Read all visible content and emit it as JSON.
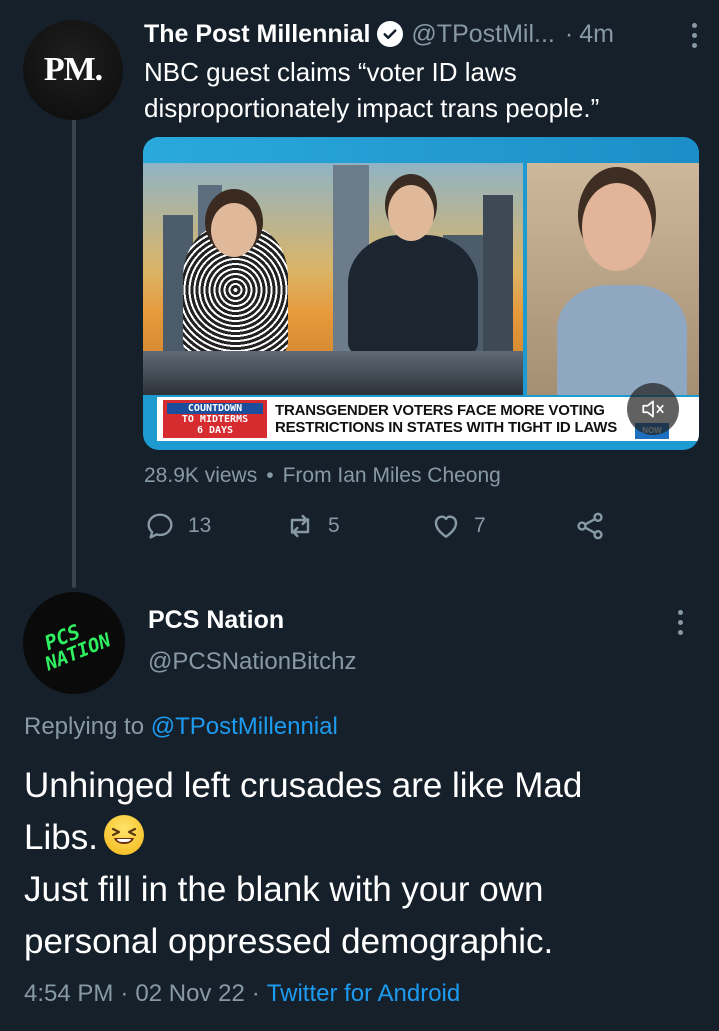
{
  "tweet1": {
    "avatar_text": "PM.",
    "name": "The Post Millennial",
    "handle": "@TPostMil...",
    "separator": "·",
    "time": "4m",
    "text_line1": "NBC guest claims “voter ID laws",
    "text_line2": "disproportionately impact trans people.”",
    "media": {
      "countdown_line1": "COUNTDOWN",
      "countdown_line2": "TO MIDTERMS",
      "countdown_line3": "6 DAYS",
      "headline_line1": "TRANSGENDER VOTERS FACE MORE VOTING",
      "headline_line2": "RESTRICTIONS IN STATES WITH TIGHT ID LAWS",
      "network_logo": "NOW"
    },
    "views": "28.9K views",
    "views_separator": "•",
    "from": "From Ian Miles Cheong",
    "replies": "13",
    "retweets": "5",
    "likes": "7"
  },
  "tweet2": {
    "avatar_line1": "PCS",
    "avatar_line2": "NATION",
    "name": "PCS Nation",
    "handle": "@PCSNationBitchz",
    "replying_prefix": "Replying to",
    "replying_to": "@TPostMillennial",
    "body_line1": "Unhinged left crusades are like Mad",
    "body_line2": "Libs.",
    "body_line3": "Just fill in the blank with your own",
    "body_line4": "personal oppressed demographic.",
    "time": "4:54 PM",
    "date": "02 Nov 22",
    "separator": "·",
    "source": "Twitter for Android"
  },
  "colors": {
    "background": "#15202b",
    "secondary_text": "#8899a6",
    "link": "#1d9bf0"
  }
}
